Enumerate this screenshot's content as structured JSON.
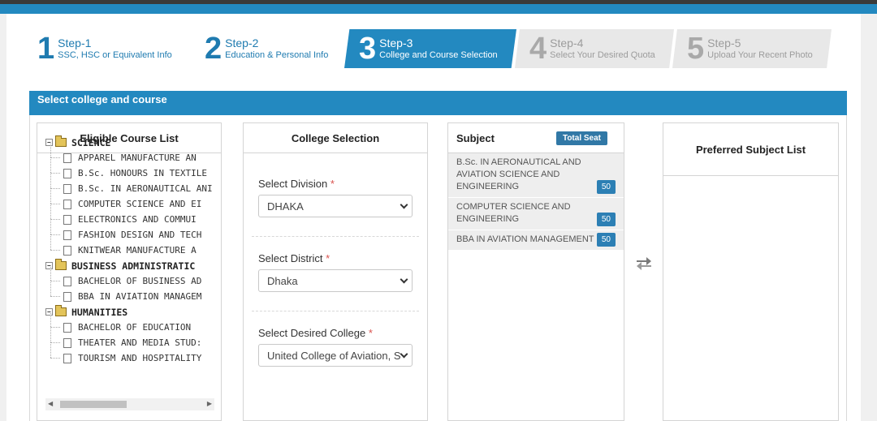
{
  "steps": [
    {
      "num": "1",
      "title": "Step-1",
      "subtitle": "SSC, HSC or Equivalent Info"
    },
    {
      "num": "2",
      "title": "Step-2",
      "subtitle": "Education & Personal Info"
    },
    {
      "num": "3",
      "title": "Step-3",
      "subtitle": "College and Course Selection"
    },
    {
      "num": "4",
      "title": "Step-4",
      "subtitle": "Select Your Desired Quota"
    },
    {
      "num": "5",
      "title": "Step-5",
      "subtitle": "Upload Your Recent Photo"
    }
  ],
  "section": {
    "title": "Select college and course"
  },
  "courses": {
    "title": "Eligible Course List",
    "categories": [
      {
        "name": "SCIENCE",
        "items": [
          "APPAREL MANUFACTURE AN",
          "B.Sc. HONOURS IN TEXTILE",
          "B.Sc. IN AERONAUTICAL ANI",
          "COMPUTER SCIENCE AND EI",
          "ELECTRONICS AND COMMUI",
          "FASHION DESIGN AND TECH",
          "KNITWEAR MANUFACTURE A"
        ]
      },
      {
        "name": "BUSINESS ADMINISTRATIC",
        "items": [
          "BACHELOR OF BUSINESS AD",
          "BBA IN AVIATION MANAGEM"
        ]
      },
      {
        "name": "HUMANITIES",
        "items": [
          "BACHELOR OF EDUCATION",
          "THEATER AND MEDIA STUD:",
          "TOURISM AND HOSPITALITY"
        ]
      }
    ]
  },
  "college": {
    "title": "College Selection",
    "division_label": "Select Division",
    "division_value": "DHAKA",
    "district_label": "Select District",
    "district_value": "Dhaka",
    "college_label": "Select Desired College",
    "college_value": "United College of Aviation, S",
    "required_mark": "*"
  },
  "subject": {
    "title": "Subject",
    "total_seat_label": "Total Seat",
    "items": [
      {
        "name": "B.Sc. IN AERONAUTICAL AND AVIATION SCIENCE AND ENGINEERING",
        "seats": "50"
      },
      {
        "name": "COMPUTER SCIENCE AND ENGINEERING",
        "seats": "50"
      },
      {
        "name": "BBA IN AVIATION MANAGEMENT",
        "seats": "50"
      }
    ]
  },
  "preferred": {
    "title": "Preferred Subject List"
  },
  "icons": {
    "swap": "swap-arrows-icon",
    "folder": "folder-icon",
    "document": "document-icon"
  }
}
